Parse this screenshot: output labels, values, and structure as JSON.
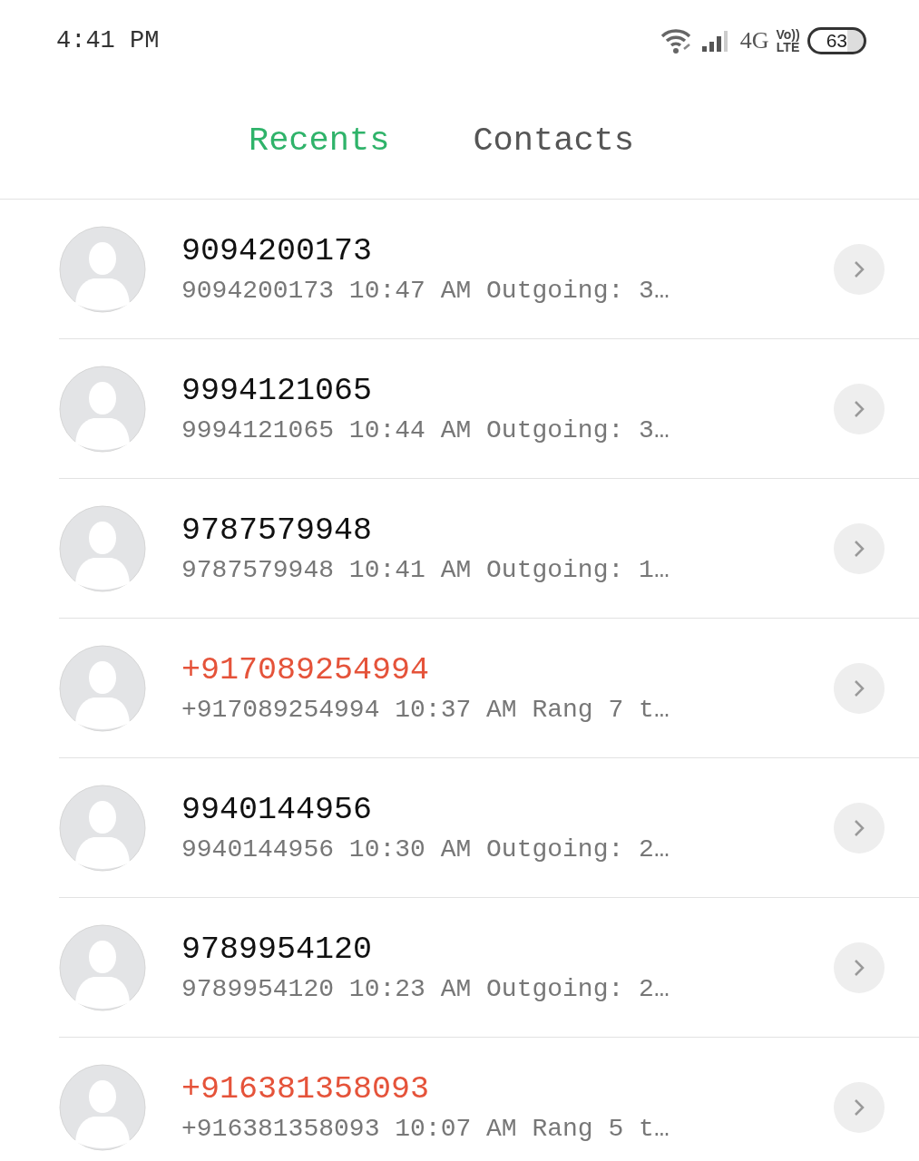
{
  "status_bar": {
    "time": "4:41 PM",
    "network": "4G",
    "volte": "Vo)) LTE",
    "battery": "63"
  },
  "tabs": [
    {
      "label": "Recents",
      "selected": true
    },
    {
      "label": "Contacts",
      "selected": false
    }
  ],
  "calls": [
    {
      "name": "9094200173",
      "detail": "9094200173 10:47 AM Outgoing: 3…",
      "missed": false
    },
    {
      "name": "9994121065",
      "detail": "9994121065 10:44 AM Outgoing: 3…",
      "missed": false
    },
    {
      "name": "9787579948",
      "detail": "9787579948 10:41 AM Outgoing: 1…",
      "missed": false
    },
    {
      "name": "+917089254994",
      "detail": "+917089254994 10:37 AM Rang 7 t…",
      "missed": true
    },
    {
      "name": "9940144956",
      "detail": "9940144956 10:30 AM Outgoing: 2…",
      "missed": false
    },
    {
      "name": "9789954120",
      "detail": "9789954120 10:23 AM Outgoing: 2…",
      "missed": false
    },
    {
      "name": "+916381358093",
      "detail": "+916381358093 10:07 AM Rang 5 t…",
      "missed": true
    }
  ]
}
